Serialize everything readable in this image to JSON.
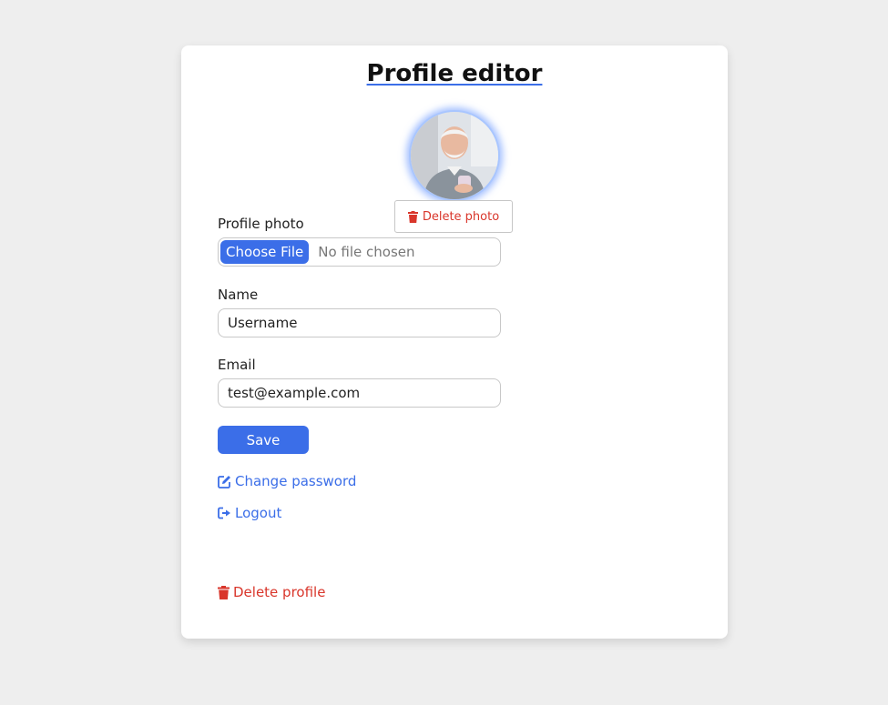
{
  "page": {
    "title": "Profile editor"
  },
  "photo": {
    "delete_label": "Delete photo",
    "label": "Profile photo",
    "choose_label": "Choose File",
    "no_file_text": "No file chosen"
  },
  "name": {
    "label": "Name",
    "value": "Username"
  },
  "email": {
    "label": "Email",
    "value": "test@example.com"
  },
  "actions": {
    "save_label": "Save",
    "change_password_label": "Change password",
    "logout_label": "Logout",
    "delete_profile_label": "Delete profile"
  },
  "colors": {
    "accent": "#3b6ee8",
    "danger": "#d9362b",
    "background": "#eeeeee"
  },
  "icons": {
    "delete_photo": "trash-icon",
    "change_password": "edit-icon",
    "logout": "logout-icon",
    "delete_profile": "trash-icon"
  }
}
